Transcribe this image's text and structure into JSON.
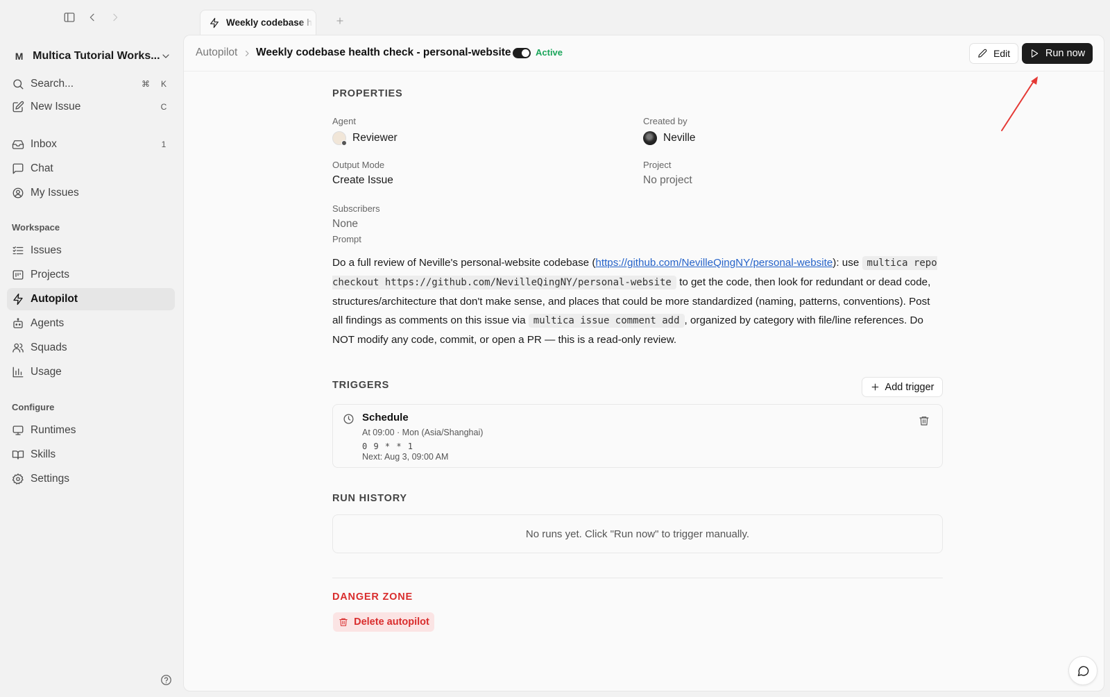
{
  "tab": {
    "title": "Weekly codebase health check - personal-website"
  },
  "sidebar": {
    "workspace_initial": "M",
    "workspace_name": "Multica Tutorial Works...",
    "search": {
      "label": "Search...",
      "shortcut_mod": "⌘",
      "shortcut_key": "K"
    },
    "new_issue": {
      "label": "New Issue",
      "shortcut": "C"
    },
    "primary": [
      {
        "label": "Inbox",
        "count": "1"
      },
      {
        "label": "Chat"
      },
      {
        "label": "My Issues"
      }
    ],
    "workspace_section": "Workspace",
    "workspace_items": [
      {
        "label": "Issues"
      },
      {
        "label": "Projects"
      },
      {
        "label": "Autopilot"
      },
      {
        "label": "Agents"
      },
      {
        "label": "Squads"
      },
      {
        "label": "Usage"
      }
    ],
    "configure_section": "Configure",
    "configure_items": [
      {
        "label": "Runtimes"
      },
      {
        "label": "Skills"
      },
      {
        "label": "Settings"
      }
    ]
  },
  "header": {
    "breadcrumb": "Autopilot",
    "title": "Weekly codebase health check - personal-website",
    "status": "Active",
    "toggle_on": true,
    "edit_label": "Edit",
    "run_label": "Run now"
  },
  "properties": {
    "heading": "PROPERTIES",
    "agent_label": "Agent",
    "agent_value": "Reviewer",
    "created_by_label": "Created by",
    "created_by_value": "Neville",
    "output_mode_label": "Output Mode",
    "output_mode_value": "Create Issue",
    "project_label": "Project",
    "project_value": "No project",
    "subscribers_label": "Subscribers",
    "subscribers_value": "None",
    "prompt_label": "Prompt",
    "prompt": {
      "t1": "Do a full review of Neville's personal-website codebase (",
      "link": "https://github.com/NevilleQingNY/personal-website",
      "t2": "): use ",
      "code1": "multica repo checkout https://github.com/NevilleQingNY/personal-website",
      "t3": " to get the code, then look for redundant or dead code, structures/architecture that don't make sense, and places that could be more standardized (naming, patterns, conventions). Post all findings as comments on this issue via ",
      "code2": "multica issue comment add",
      "t4": ", organized by category with file/line references. Do NOT modify any code, commit, or open a PR — this is a read-only review."
    }
  },
  "triggers": {
    "heading": "TRIGGERS",
    "add_label": "Add trigger",
    "schedule": {
      "title": "Schedule",
      "description": "At 09:00 · Mon (Asia/Shanghai)",
      "cron": "0 9 * * 1",
      "next": "Next: Aug 3, 09:00 AM"
    }
  },
  "run_history": {
    "heading": "RUN HISTORY",
    "empty": "No runs yet. Click \"Run now\" to trigger manually."
  },
  "danger": {
    "heading": "DANGER ZONE",
    "delete_label": "Delete autopilot"
  },
  "colors": {
    "accent_dark": "#1c1c1c",
    "active_green": "#1aa55a",
    "danger_red": "#d92d2d",
    "link_blue": "#2563c9",
    "annotation_arrow": "#e53935"
  },
  "icons": [
    "sidebar-toggle-icon",
    "back-icon",
    "forward-icon",
    "zap-icon",
    "plus-icon",
    "chevron-down-icon",
    "search-icon",
    "edit-icon",
    "inbox-icon",
    "chat-icon",
    "user-circle-icon",
    "list-icon",
    "projects-icon",
    "bot-icon",
    "users-icon",
    "bar-chart-icon",
    "monitor-icon",
    "book-icon",
    "gear-icon",
    "help-icon",
    "chevron-right-icon",
    "pencil-icon",
    "play-icon",
    "clock-icon",
    "trash-icon",
    "message-icon",
    "annotation-arrow"
  ]
}
